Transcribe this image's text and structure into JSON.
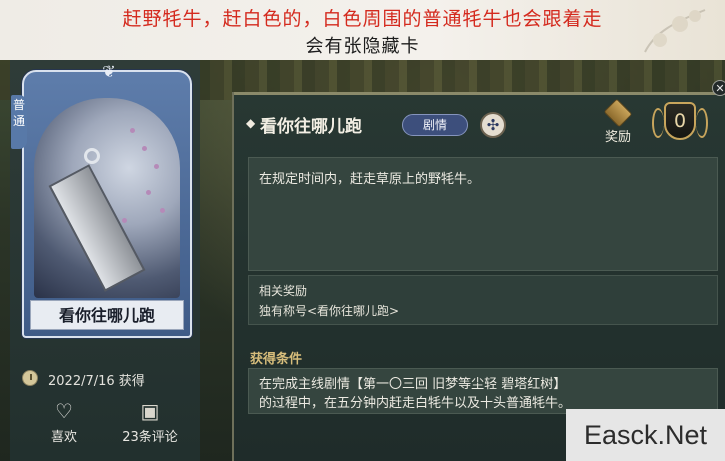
{
  "caption": {
    "line1": "赶野牦牛，赶白色的，白色周围的普通牦牛也会跟着走",
    "line2": "会有张隐藏卡"
  },
  "card": {
    "rarity": "普通",
    "title": "看你往哪儿跑",
    "date": "2022/7/16  获得",
    "likes_label": "喜欢",
    "comments_label": "23条评论",
    "icons": [
      "clock-icon",
      "heart-icon",
      "chat-bubble-icon"
    ]
  },
  "task": {
    "name": "看你往哪儿跑",
    "category_badge": "剧情",
    "reward_label": "奖励",
    "reward_count": "0",
    "description": "在规定时间内，赶走草原上的野牦牛。",
    "related_reward_heading": "相关奖励",
    "related_reward_value": "独有称号<看你往哪儿跑>",
    "condition_heading": "获得条件",
    "condition_line1": "在完成主线剧情【第一〇三回  旧梦等尘轻  碧塔红树】",
    "condition_line2": "的过程中，在五分钟内赶走白牦牛以及十头普通牦牛。"
  },
  "close_label": "✕",
  "watermark": "Easck.Net",
  "colors": {
    "caption_red": "#d42a1e",
    "card_blue": "#5e7dab",
    "panel_bg": "#283833",
    "condition_gold": "#d7bd7b",
    "badge_blue": "#3d4f7c"
  }
}
